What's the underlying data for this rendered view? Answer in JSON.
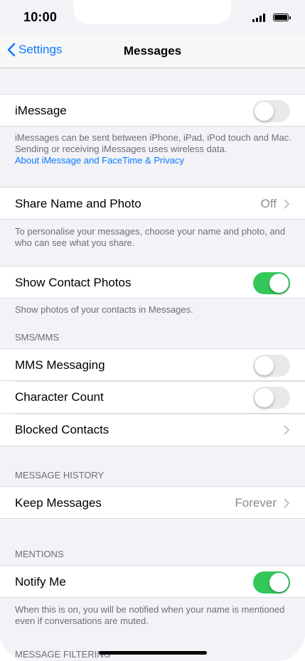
{
  "status_bar": {
    "time": "10:00"
  },
  "nav": {
    "back_label": "Settings",
    "title": "Messages"
  },
  "imessage": {
    "label": "iMessage",
    "enabled": false,
    "footer": "iMessages can be sent between iPhone, iPad, iPod touch and Mac. Sending or receiving iMessages uses wireless data.",
    "link": "About iMessage and FaceTime & Privacy"
  },
  "share_name_photo": {
    "label": "Share Name and Photo",
    "value": "Off",
    "footer": "To personalise your messages, choose your name and photo, and who can see what you share."
  },
  "show_contact_photos": {
    "label": "Show Contact Photos",
    "enabled": true,
    "footer": "Show photos of your contacts in Messages."
  },
  "sms_mms": {
    "header": "SMS/MMS",
    "mms_label": "MMS Messaging",
    "mms_enabled": false,
    "char_count_label": "Character Count",
    "char_count_enabled": false,
    "blocked_label": "Blocked Contacts"
  },
  "message_history": {
    "header": "MESSAGE HISTORY",
    "keep_label": "Keep Messages",
    "keep_value": "Forever"
  },
  "mentions": {
    "header": "MENTIONS",
    "notify_label": "Notify Me",
    "notify_enabled": true,
    "footer": "When this is on, you will be notified when your name is mentioned even if conversations are muted."
  },
  "message_filtering": {
    "header": "MESSAGE FILTERING"
  },
  "colors": {
    "accent": "#0a7aff",
    "toggle_on": "#34c759",
    "toggle_off": "#e9e9ea",
    "background": "#f2f2f7"
  }
}
